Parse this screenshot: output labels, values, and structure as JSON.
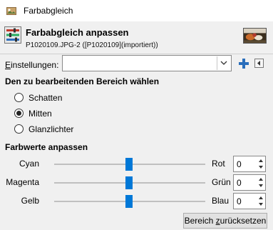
{
  "window": {
    "title": "Farbabgleich"
  },
  "header": {
    "title": "Farbabgleich anpassen",
    "subtitle": "P1020109.JPG-2 ([P1020109](importiert))"
  },
  "presets": {
    "label_mnemonic": "E",
    "label_rest": "instellungen:",
    "value": ""
  },
  "range": {
    "heading": "Den zu bearbeitenden Bereich wählen",
    "options": [
      {
        "label": "Schatten",
        "selected": false
      },
      {
        "label": "Mitten",
        "selected": true
      },
      {
        "label": "Glanzlichter",
        "selected": false
      }
    ]
  },
  "levels": {
    "heading": "Farbwerte anpassen",
    "sliders": [
      {
        "left": "Cyan",
        "right": "Rot",
        "value": "0"
      },
      {
        "left": "Magenta",
        "right": "Grün",
        "value": "0"
      },
      {
        "left": "Gelb",
        "right": "Blau",
        "value": "0"
      }
    ]
  },
  "reset_button": {
    "prefix": "Bereich ",
    "mnemonic": "z",
    "rest": "urücksetzen"
  },
  "colors": {
    "slider_thumb": "#0078d7",
    "plus_icon": "#2a6ebb"
  },
  "icons": {
    "title": "gimp-icon",
    "tool": "color-balance-icon",
    "preview": "image-thumbnail",
    "add": "plus-icon",
    "menu": "triangle-left-icon",
    "combo": "chevron-down-icon"
  }
}
